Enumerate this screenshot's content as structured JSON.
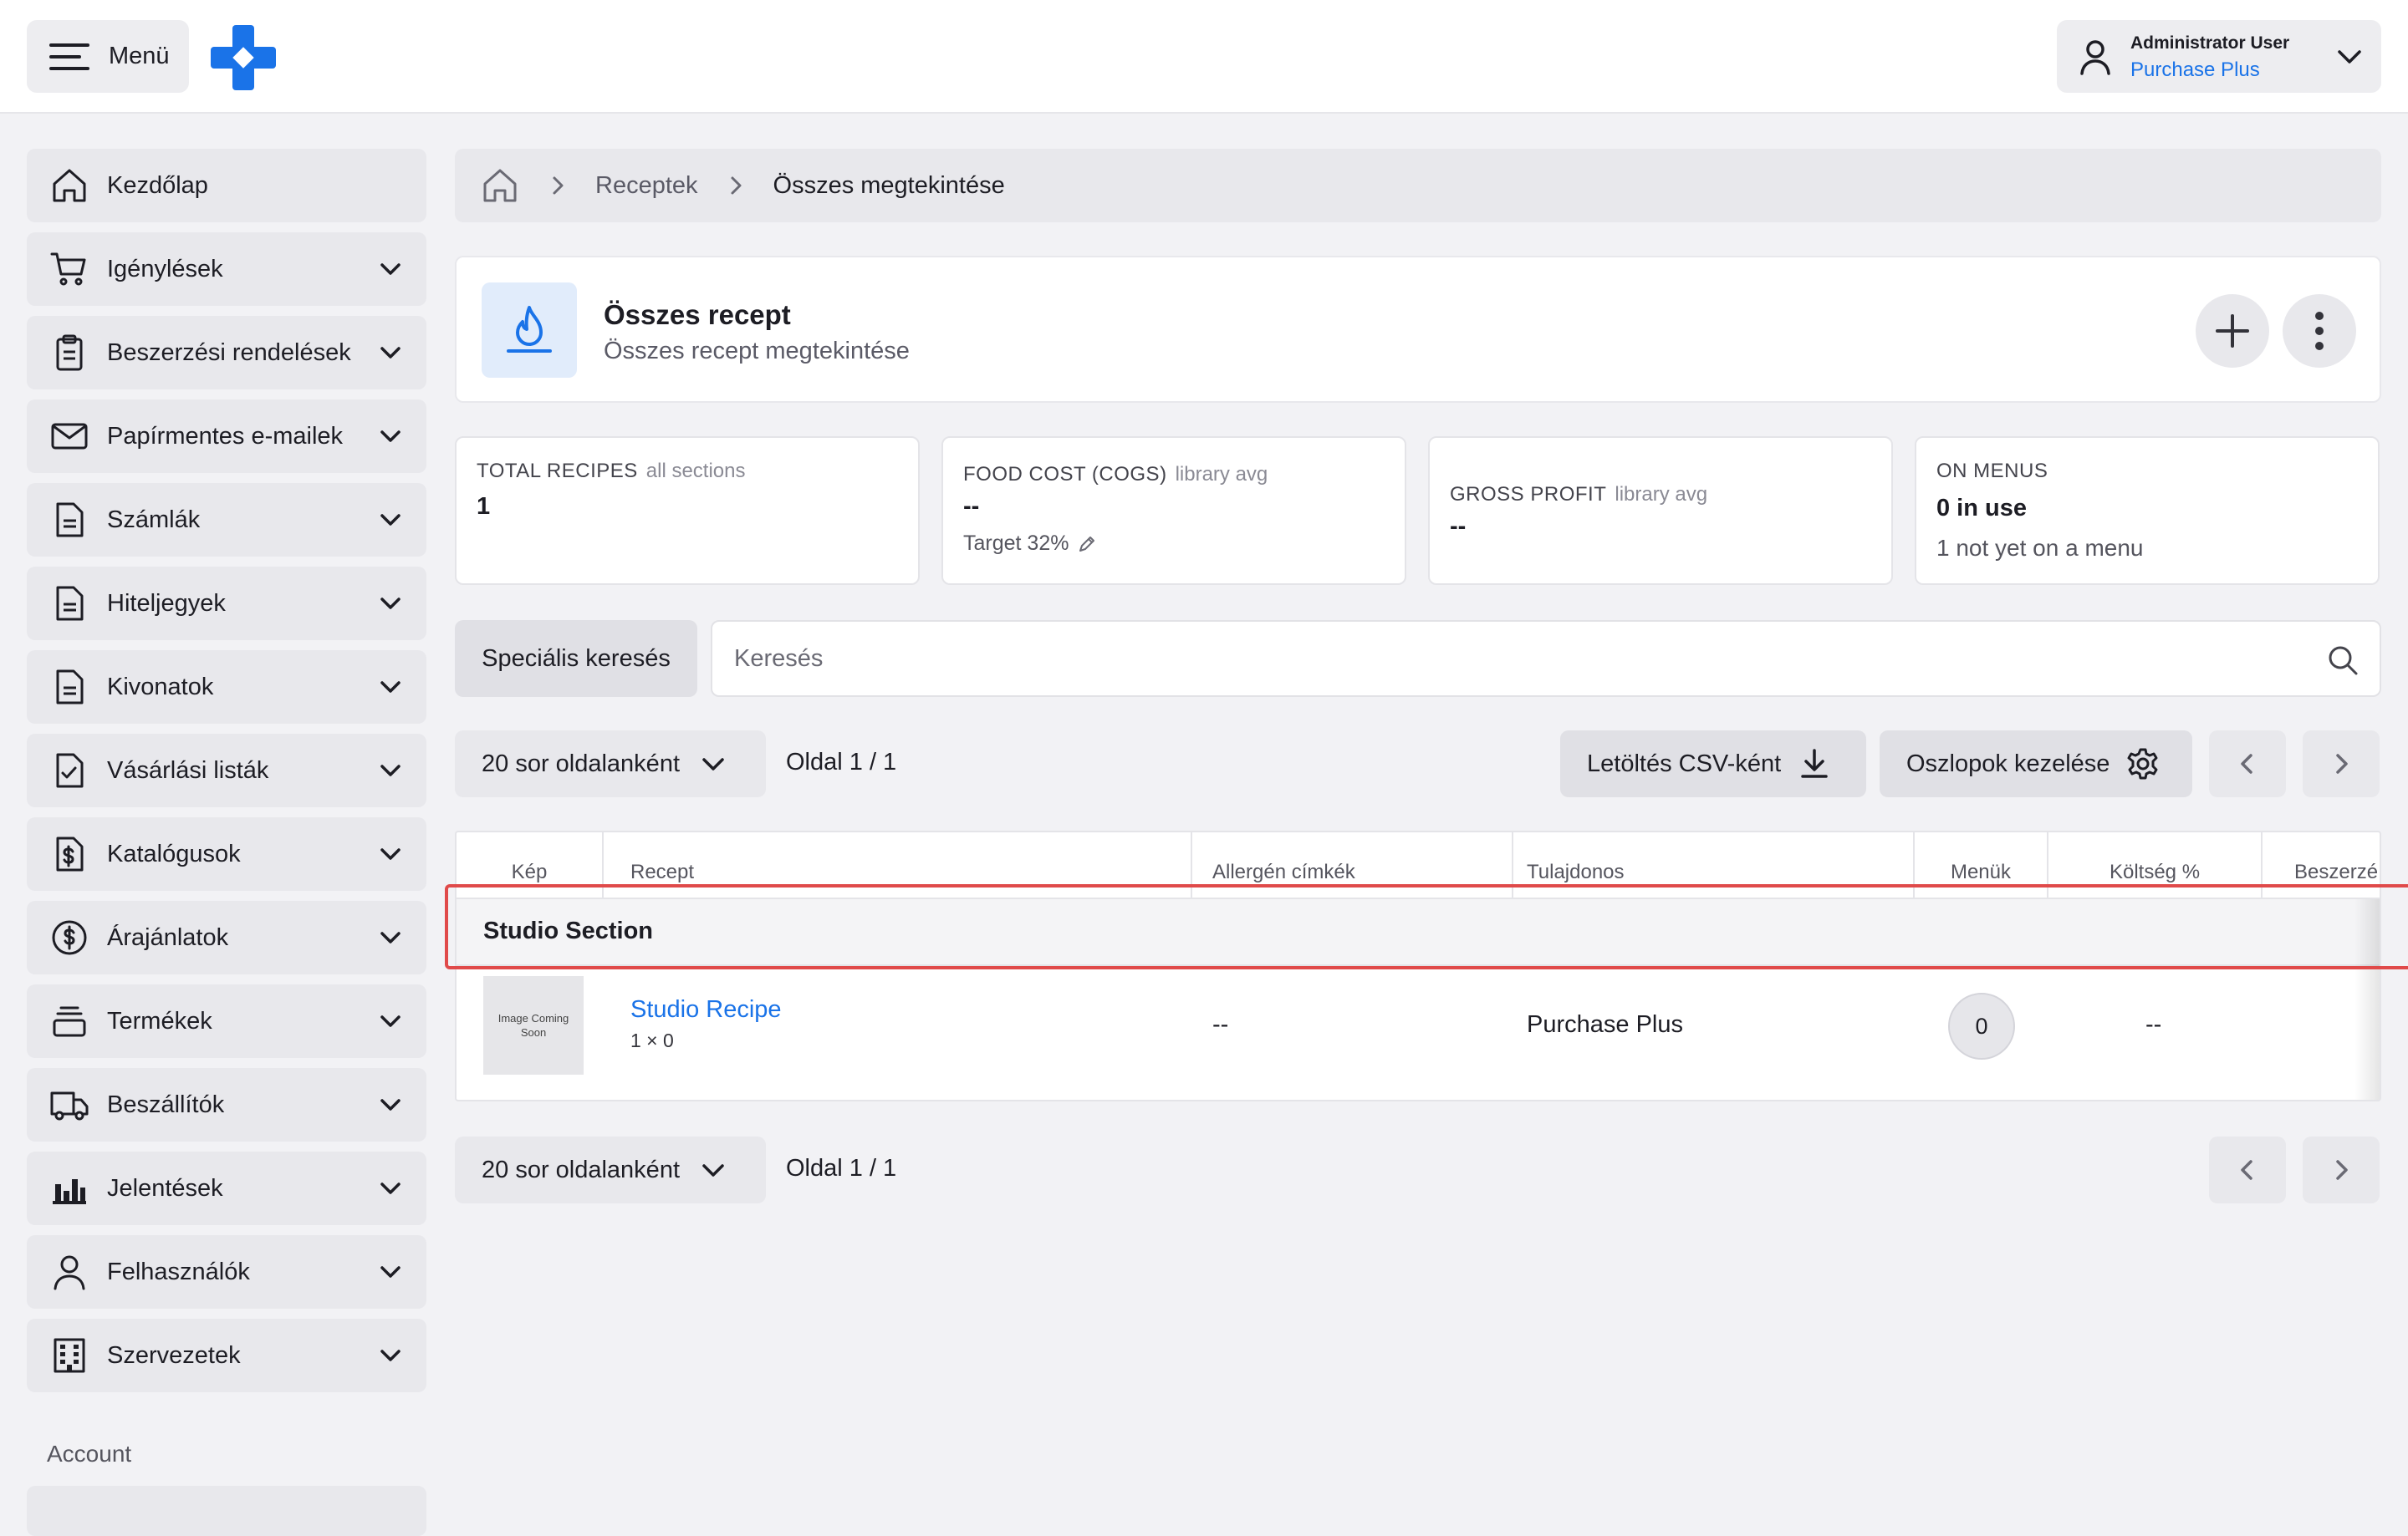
{
  "topbar": {
    "menu_label": "Menü",
    "user_name": "Administrator User",
    "user_org": "Purchase Plus"
  },
  "sidebar": {
    "items": [
      {
        "label": "Kezdőlap",
        "icon": "home-icon",
        "has_chevron": false
      },
      {
        "label": "Igénylések",
        "icon": "cart-icon",
        "has_chevron": true
      },
      {
        "label": "Beszerzési rendelések",
        "icon": "clipboard-icon",
        "has_chevron": true
      },
      {
        "label": "Papírmentes e-mailek",
        "icon": "mail-icon",
        "has_chevron": true
      },
      {
        "label": "Számlák",
        "icon": "document-icon",
        "has_chevron": true
      },
      {
        "label": "Hiteljegyek",
        "icon": "document-icon",
        "has_chevron": true
      },
      {
        "label": "Kivonatok",
        "icon": "document-icon",
        "has_chevron": true
      },
      {
        "label": "Vásárlási listák",
        "icon": "checklist-icon",
        "has_chevron": true
      },
      {
        "label": "Katalógusok",
        "icon": "dollar-document-icon",
        "has_chevron": true
      },
      {
        "label": "Árajánlatok",
        "icon": "dollar-circle-icon",
        "has_chevron": true
      },
      {
        "label": "Termékek",
        "icon": "stack-icon",
        "has_chevron": true
      },
      {
        "label": "Beszállítók",
        "icon": "truck-icon",
        "has_chevron": true
      },
      {
        "label": "Jelentések",
        "icon": "bar-chart-icon",
        "has_chevron": true
      },
      {
        "label": "Felhasználók",
        "icon": "user-icon",
        "has_chevron": true
      },
      {
        "label": "Szervezetek",
        "icon": "building-icon",
        "has_chevron": true
      }
    ],
    "section_label": "Account"
  },
  "breadcrumb": {
    "items": [
      "Receptek",
      "Összes megtekintése"
    ]
  },
  "header": {
    "title": "Összes recept",
    "subtitle": "Összes recept megtekintése",
    "icon": "flame-icon"
  },
  "stats": [
    {
      "label": "TOTAL RECIPES",
      "sublabel": "all sections",
      "value": "1",
      "note": ""
    },
    {
      "label": "FOOD COST (COGS)",
      "sublabel": "library avg",
      "value": "--",
      "note": "Target 32%"
    },
    {
      "label": "GROSS PROFIT",
      "sublabel": "library avg",
      "value": "--",
      "note": ""
    },
    {
      "label": "ON MENUS",
      "sublabel": "",
      "value": "0 in use",
      "note": "1 not yet on a menu"
    }
  ],
  "search": {
    "advanced_label": "Speciális keresés",
    "placeholder": "Keresés"
  },
  "pagination": {
    "rows_per_page": "20 sor oldalanként",
    "page_info": "Oldal 1 / 1"
  },
  "toolbar": {
    "csv_label": "Letöltés CSV-ként",
    "columns_label": "Oszlopok kezelése"
  },
  "table": {
    "columns": [
      "Kép",
      "Recept",
      "Allergén címkék",
      "Tulajdonos",
      "Menük",
      "Költség %",
      "Beszerzé"
    ],
    "section_name": "Studio Section",
    "rows": [
      {
        "image_placeholder": "Image Coming Soon",
        "recipe": "Studio Recipe",
        "yield": "1 × 0",
        "allergens": "--",
        "owner": "Purchase Plus",
        "menus": "0",
        "cost_pct": "--"
      }
    ]
  },
  "colors": {
    "accent": "#1a73e8",
    "highlight": "#e04a4a",
    "background": "#f2f2f5"
  }
}
